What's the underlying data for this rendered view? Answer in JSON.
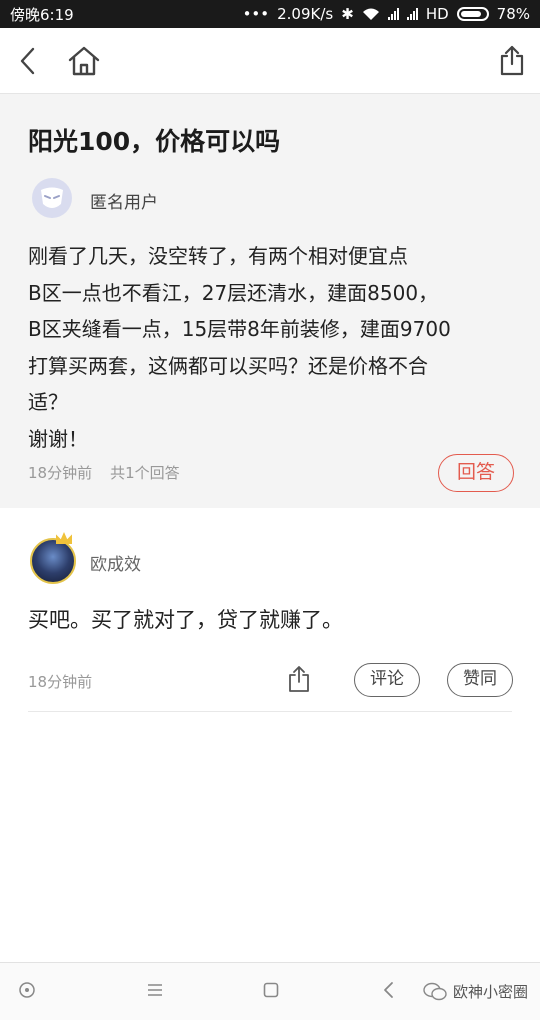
{
  "status_bar": {
    "time": "傍晚6:19",
    "dots": "•••",
    "speed": "2.09K/s",
    "bluetooth": "✱",
    "hd": "HD",
    "battery": "78%"
  },
  "nav": {
    "back_icon": "chevron-left-icon",
    "home_icon": "home-icon",
    "share_icon": "share-icon"
  },
  "question": {
    "title": "阳光100，价格可以吗",
    "user": "匿名用户",
    "body_lines": [
      "刚看了几天，没空转了，有两个相对便宜点",
      "B区一点也不看江，27层还清水，建面8500，",
      "B区夹缝看一点，15层带8年前装修，建面9700",
      "打算买两套，这俩都可以买吗？还是价格不合",
      "适？",
      "谢谢！"
    ],
    "time": "18分钟前",
    "answers_count": "共1个回答",
    "answer_button": "回答"
  },
  "answer": {
    "user": "欧成效",
    "body": "买吧。买了就对了，贷了就赚了。",
    "time": "18分钟前",
    "comment_button": "评论",
    "like_button": "赞同"
  },
  "watermark": "欧神小密圈",
  "colors": {
    "accent": "#e35b4e",
    "question_bg": "#f4f4f4",
    "status_bar": "#1a1a1a"
  }
}
